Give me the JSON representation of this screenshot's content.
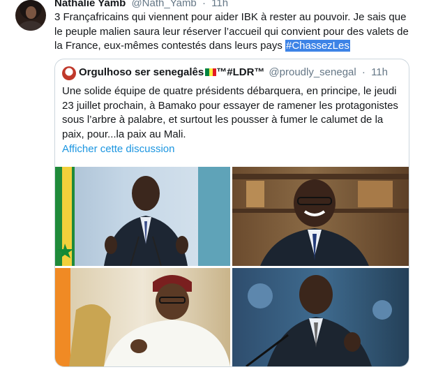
{
  "tweet": {
    "author_name": "Nathalie Yamb",
    "author_handle": "@Nath_Yamb",
    "separator": "·",
    "time": "11h",
    "text_before": "3 Françafricains qui viennent pour aider IBK à rester au pouvoir. Je sais que le peuple malien saura leur réserver l’accueil qui convient pour des valets de la France, eux-mêmes contestés dans leurs pays ",
    "hashtag": "#ChassezLes"
  },
  "quote": {
    "author_name": "Orgulhoso ser senegalês",
    "name_suffix": "™#LDR™",
    "author_handle": "@proudly_senegal",
    "separator": "·",
    "time": "11h",
    "text": "Une solide équipe de quatre présidents débarquera, en principe, le jeudi 23 juillet prochain, à Bamako pour essayer de ramener les protagonistes sous l’arbre à palabre, et surtout les pousser à fumer le calumet de la paix, pour...la paix au Mali.",
    "show_thread": "Afficher cette discussion",
    "link_color": "#1b95e0",
    "flag_colors": [
      "#00853f",
      "#fdef42",
      "#e31b23"
    ]
  },
  "colors": {
    "hashtag_highlight": "#3d83e6",
    "muted_text": "#657786",
    "border": "#ccd6dd"
  }
}
